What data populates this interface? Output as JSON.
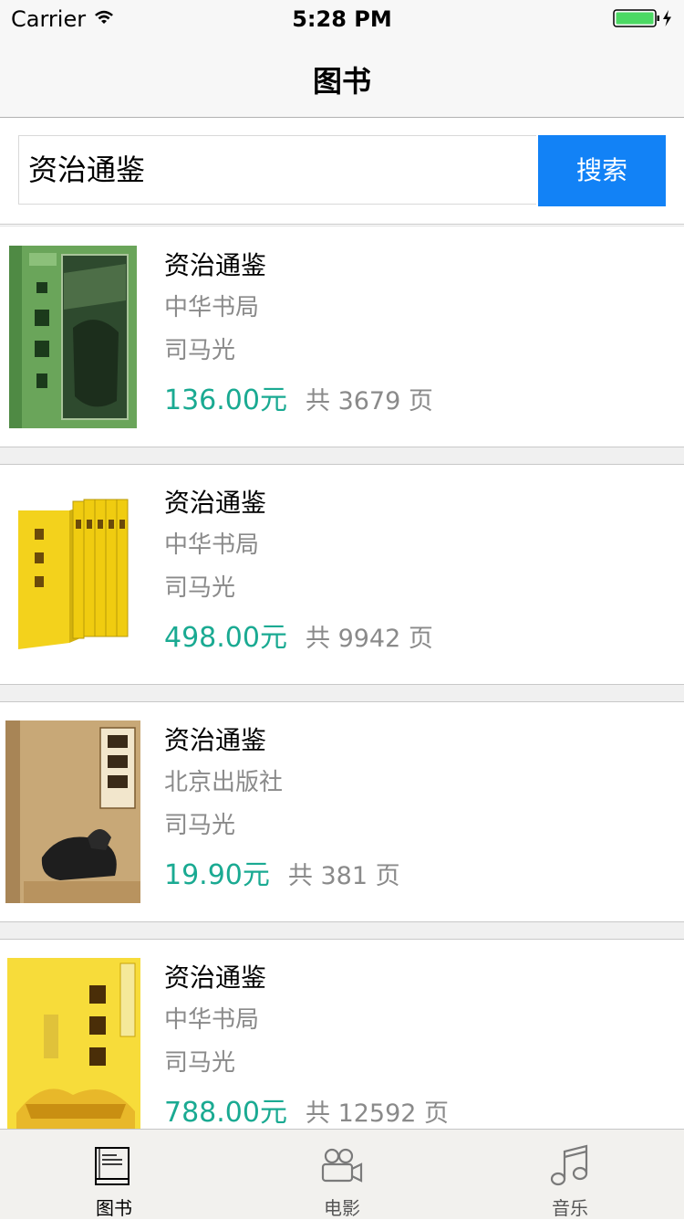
{
  "status": {
    "carrier": "Carrier",
    "time": "5:28 PM"
  },
  "nav": {
    "title": "图书"
  },
  "search": {
    "value": "资治通鉴",
    "button": "搜索"
  },
  "books": [
    {
      "title": "资治通鉴",
      "publisher": "中华书局",
      "author": "司马光",
      "price": "136.00元",
      "pages": "共 3679 页"
    },
    {
      "title": "资治通鉴",
      "publisher": "中华书局",
      "author": "司马光",
      "price": "498.00元",
      "pages": "共 9942 页"
    },
    {
      "title": "资治通鉴",
      "publisher": "北京出版社",
      "author": "司马光",
      "price": "19.90元",
      "pages": "共 381 页"
    },
    {
      "title": "资治通鉴",
      "publisher": "中华书局",
      "author": "司马光",
      "price": "788.00元",
      "pages": "共 12592 页"
    }
  ],
  "tabs": [
    {
      "label": "图书",
      "icon": "book-icon",
      "active": true
    },
    {
      "label": "电影",
      "icon": "video-camera-icon",
      "active": false
    },
    {
      "label": "音乐",
      "icon": "music-note-icon",
      "active": false
    }
  ],
  "colors": {
    "accent": "#1282f6",
    "price": "#1aaa92",
    "secondary_text": "#8a8a8a"
  }
}
